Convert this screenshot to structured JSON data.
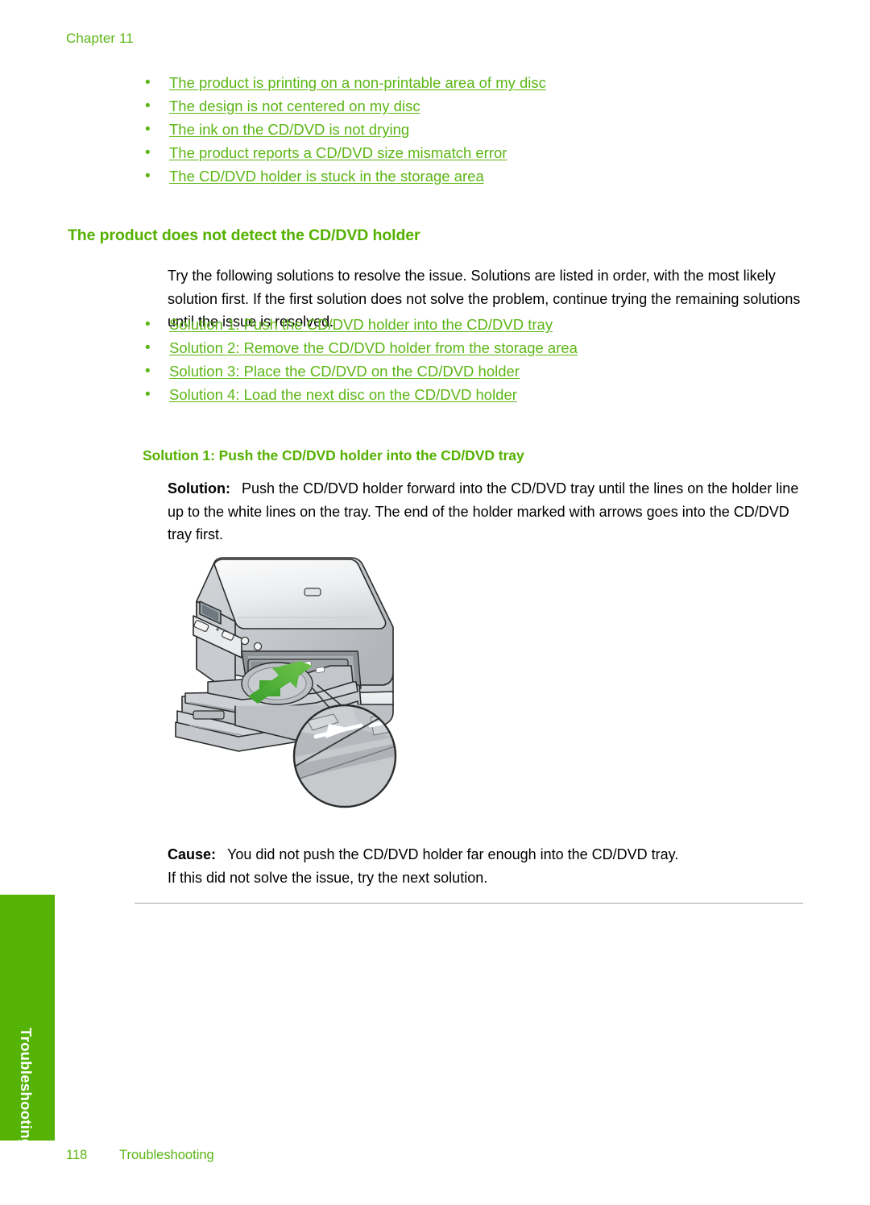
{
  "page": {
    "chapter_label": "Chapter 11",
    "background": "#ffffff"
  },
  "colors": {
    "link_green": "#5cb615",
    "heading_green": "#55b100",
    "tab_green": "#55b305",
    "rule_gray": "#a6a6a6",
    "arrow_green": "#45a32a"
  },
  "top_links": [
    {
      "bullet": "•",
      "label": "The product is printing on a non-printable area of my disc"
    },
    {
      "bullet": "•",
      "label": "The design is not centered on my disc"
    },
    {
      "bullet": "•",
      "label": "The ink on the CD/DVD is not drying"
    },
    {
      "bullet": "•",
      "label": "The product reports a CD/DVD size mismatch error"
    },
    {
      "bullet": "•",
      "label": "The CD/DVD holder is stuck in the storage area"
    }
  ],
  "section": {
    "heading": "The product does not detect the CD/DVD holder",
    "intro": "Try the following solutions to resolve the issue. Solutions are listed in order, with the most likely solution first. If the first solution does not solve the problem, continue trying the remaining solutions until the issue is resolved."
  },
  "solution_links": [
    {
      "bullet": "•",
      "label": "Solution 1: Push the CD/DVD holder into the CD/DVD tray"
    },
    {
      "bullet": "•",
      "label": "Solution 2: Remove the CD/DVD holder from the storage area"
    },
    {
      "bullet": "•",
      "label": "Solution 3: Place the CD/DVD on the CD/DVD holder"
    },
    {
      "bullet": "•",
      "label": "Solution 4: Load the next disc on the CD/DVD holder"
    }
  ],
  "solution_block": {
    "sub_heading": "Solution 1: Push the CD/DVD holder into the CD/DVD tray",
    "solution_label": "Solution:",
    "solution_text": "Push the CD/DVD holder forward into the CD/DVD tray until the lines on the holder line up to the white lines on the tray. The end of the holder marked with arrows goes into the CD/DVD tray first.",
    "cause_label": "Cause:",
    "cause_text": "You did not push the CD/DVD holder far enough into the CD/DVD tray.",
    "cause_followup": "If this did not solve the issue, try the next solution."
  },
  "illustration": {
    "name": "printer-cd-tray-illustration",
    "description": "All-in-one inkjet printer with CD/DVD holder inserted into the CD/DVD tray, a green arrow indicating push direction, and a magnified circular callout showing the white alignment lines and triangle arrow marking on the holder."
  },
  "side_tab": {
    "label": "Troubleshooting"
  },
  "footer": {
    "page_number": "118",
    "section_name": "Troubleshooting"
  }
}
